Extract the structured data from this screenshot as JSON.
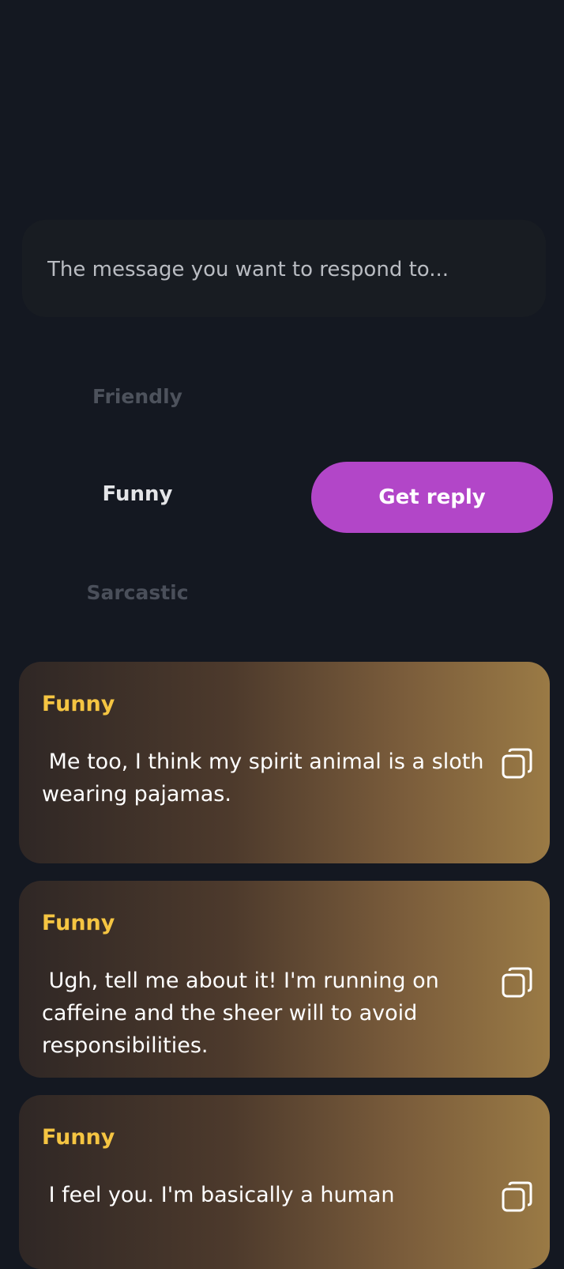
{
  "message_input": {
    "placeholder": "The message you want to respond to...",
    "value": ""
  },
  "tones": [
    {
      "label": "Friendly",
      "selected": false
    },
    {
      "label": "Funny",
      "selected": true
    },
    {
      "label": "Sarcastic",
      "selected": false
    }
  ],
  "get_reply_button": {
    "label": "Get reply",
    "color": "#b246c8"
  },
  "replies": [
    {
      "tone": "Funny",
      "text": " Me too, I think my spirit animal is a sloth wearing pajamas."
    },
    {
      "tone": "Funny",
      "text": " Ugh, tell me about it! I'm running on caffeine and the sheer will to avoid responsibilities."
    },
    {
      "tone": "Funny",
      "text": " I feel you. I'm basically a human"
    }
  ],
  "icons": {
    "copy": "copy-icon"
  },
  "colors": {
    "background": "#141821",
    "accent": "#b246c8",
    "tone_title": "#f5c542"
  }
}
